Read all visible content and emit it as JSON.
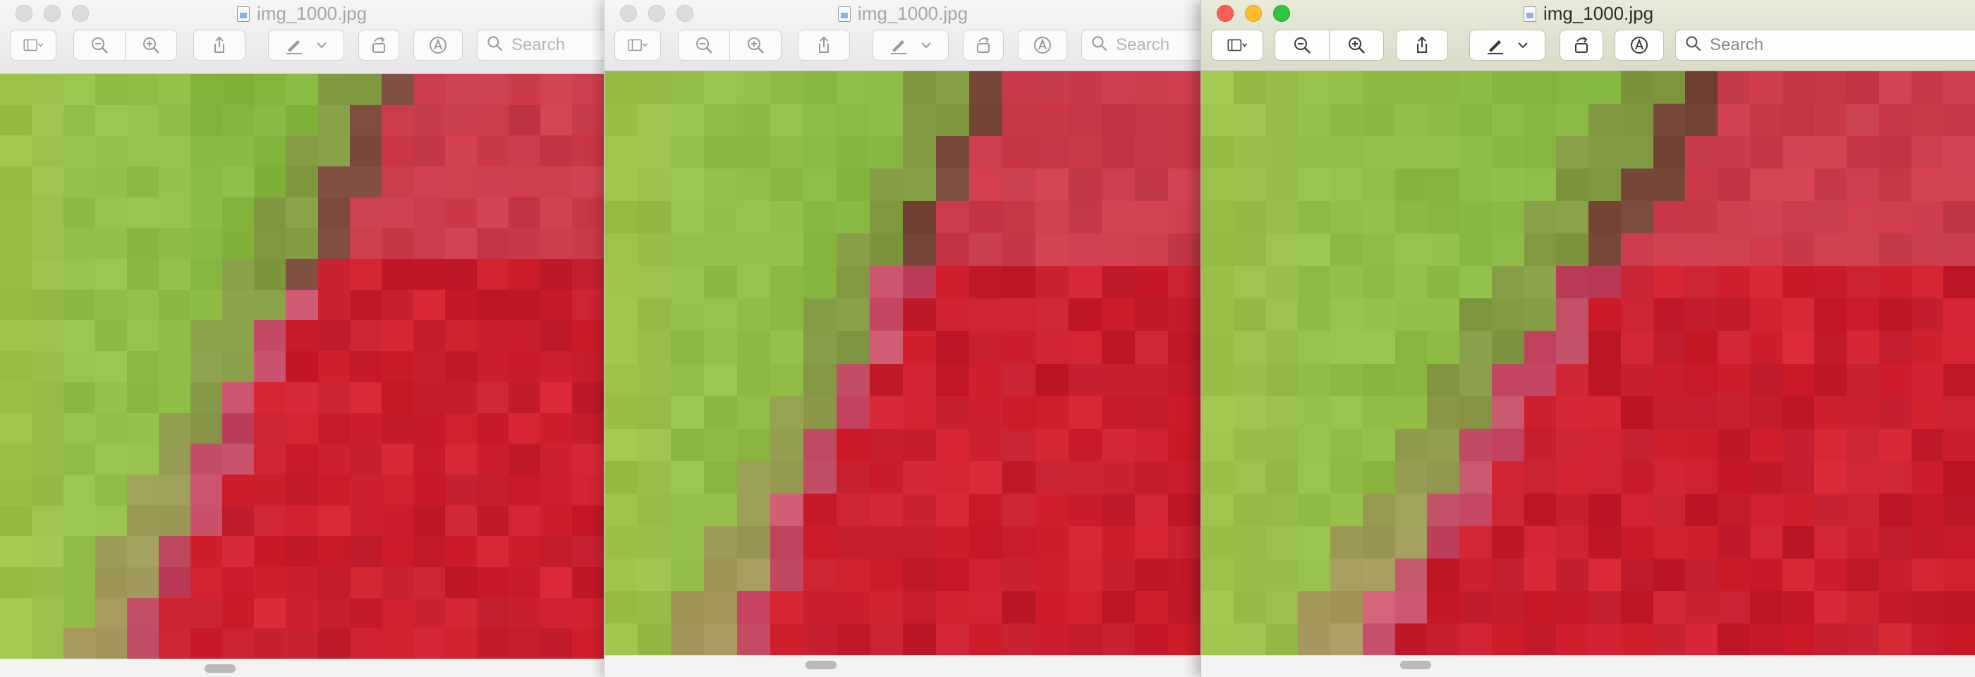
{
  "windows": [
    {
      "id": "w1",
      "title": "img_1000.jpg",
      "search_placeholder": "Search",
      "active": false
    },
    {
      "id": "w2",
      "title": "img_1000.jpg",
      "search_placeholder": "Search",
      "active": false
    },
    {
      "id": "w3",
      "title": "img_1000.jpg",
      "search_placeholder": "Search",
      "active": true
    }
  ],
  "toolbar_icons": [
    "sidebar-toggle-icon",
    "zoom-out-icon",
    "zoom-in-icon",
    "share-icon",
    "markup-pen-icon",
    "rotate-icon",
    "annotate-icon",
    "search-icon"
  ],
  "traffic_colors": {
    "close": "#ff5f57",
    "minimize": "#febc2e",
    "zoom": "#28c840"
  },
  "image_palette": {
    "green_light": "#9cc24a",
    "green": "#7cb342",
    "olive": "#8a8f4a",
    "brown": "#7b4a3a",
    "pink": "#cf5a6e",
    "red": "#d32030",
    "red_dark": "#b4182a"
  }
}
